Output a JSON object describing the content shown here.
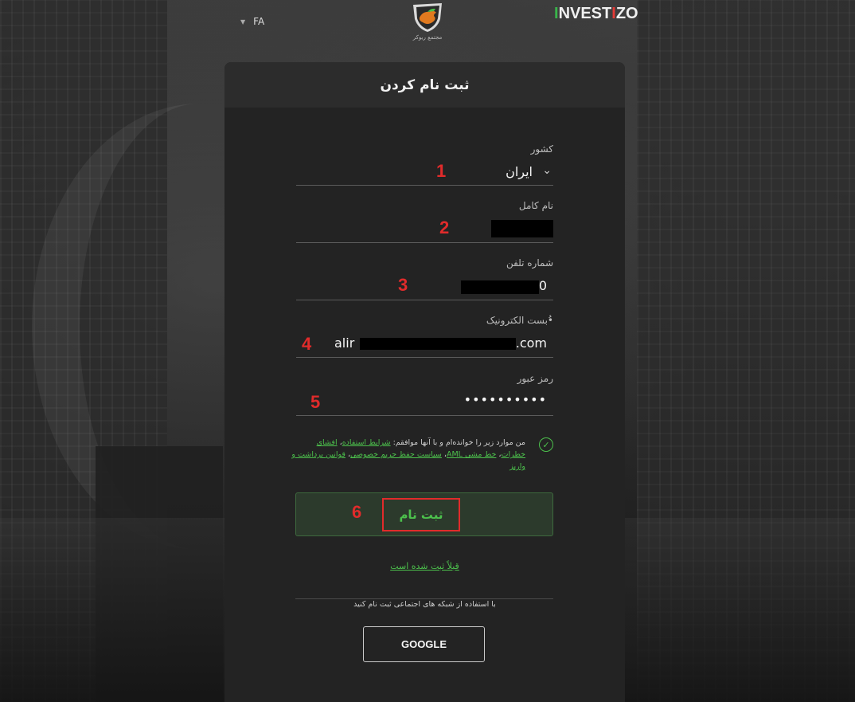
{
  "topbar": {
    "language": "FA",
    "logo_caption": "مجتمع ریوکر",
    "brand": {
      "part1": "I",
      "part2": "NVEST",
      "part3": "I",
      "part4": "ZO"
    }
  },
  "form": {
    "title": "ثبت نام کردن",
    "country": {
      "label": "کشور",
      "value": "ایران",
      "marker": "1"
    },
    "full_name": {
      "label": "نام کامل",
      "value": "...",
      "marker": "2"
    },
    "phone": {
      "label": "شماره تلفن",
      "value": "09 40",
      "marker": "3"
    },
    "email": {
      "label": "•ُبست الکترونیک",
      "value_start": "alir",
      "value_end": ".com",
      "marker": "4"
    },
    "password": {
      "label": "رمز عبور",
      "value": "••••••••••",
      "marker": "5"
    },
    "terms": {
      "prefix": "من موارد زیر را خوانده‌ام و با آنها موافقم:",
      "link_terms": "شرایط استفاده",
      "link_risk": "افشای خطرات",
      "link_aml": "خط مشی AML",
      "link_privacy": "سیاست حفظ حریم خصوصی",
      "link_withdraw": "قوانین برداشت و واریز",
      "checked": true
    },
    "submit_label": "ثبت نام",
    "submit_marker": "6",
    "already_registered": "قبلاً ثبت شده است",
    "social_divider": "با استفاده از شبکه های اجتماعی ثبت نام کنید",
    "google_label": "GOOGLE"
  },
  "colors": {
    "accent_green": "#4cc04c",
    "annotation_red": "#e12b2b",
    "card_bg": "#232323"
  }
}
